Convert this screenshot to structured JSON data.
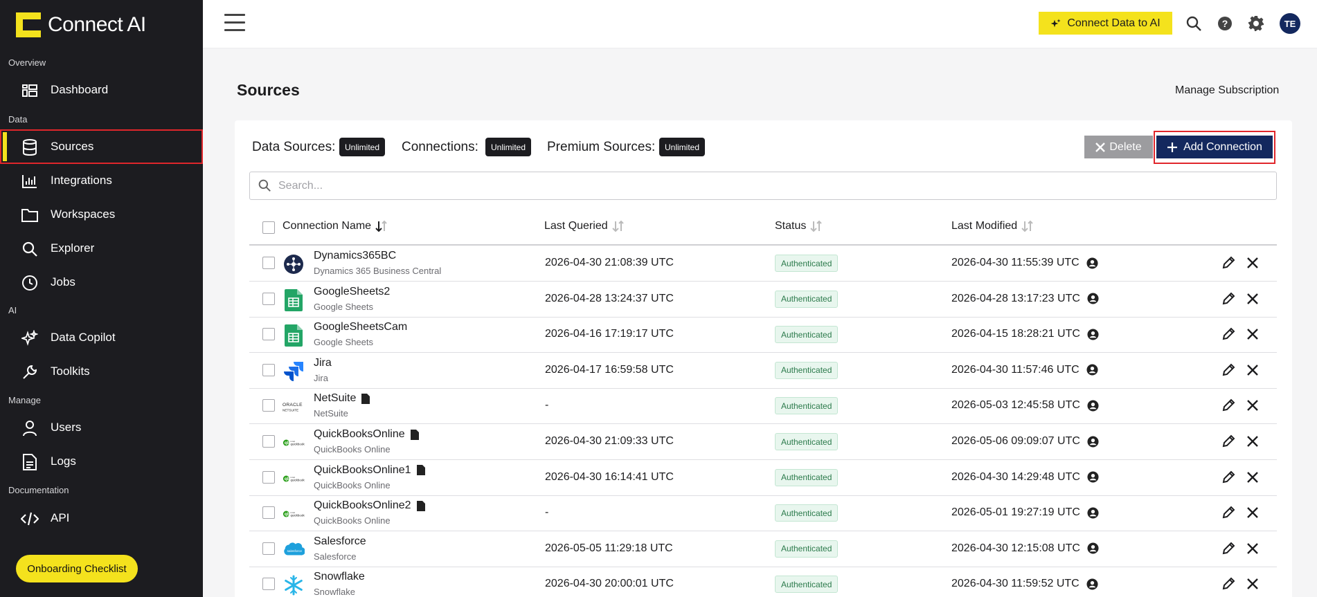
{
  "app": {
    "name": "Connect AI"
  },
  "sidebar": {
    "sections": [
      {
        "label": "Overview"
      },
      {
        "label": "Data"
      },
      {
        "label": "AI"
      },
      {
        "label": "Manage"
      },
      {
        "label": "Documentation"
      }
    ],
    "items": [
      {
        "label": "Dashboard",
        "icon": "dashboard-icon"
      },
      {
        "label": "Sources",
        "icon": "database-icon",
        "active": true
      },
      {
        "label": "Integrations",
        "icon": "bar-chart-icon"
      },
      {
        "label": "Workspaces",
        "icon": "folder-icon"
      },
      {
        "label": "Explorer",
        "icon": "search-icon"
      },
      {
        "label": "Jobs",
        "icon": "clock-icon"
      },
      {
        "label": "Data Copilot",
        "icon": "sparkle-icon"
      },
      {
        "label": "Toolkits",
        "icon": "wrench-icon"
      },
      {
        "label": "Users",
        "icon": "user-icon"
      },
      {
        "label": "Logs",
        "icon": "document-icon"
      },
      {
        "label": "API",
        "icon": "code-icon"
      }
    ],
    "onboarding_label": "Onboarding Checklist"
  },
  "topbar": {
    "connect_label": "Connect Data to AI",
    "avatar_initials": "TE",
    "accent_color": "#f4e21d",
    "brand_navy": "#13285e"
  },
  "page": {
    "title": "Sources",
    "manage_subscription": "Manage Subscription"
  },
  "stats": {
    "data_sources_label": "Data Sources:",
    "data_sources_value": "Unlimited",
    "connections_label": "Connections:",
    "connections_value": "Unlimited",
    "premium_label": "Premium Sources:",
    "premium_value": "Unlimited"
  },
  "actions": {
    "delete_label": "Delete",
    "add_label": "Add Connection"
  },
  "search": {
    "placeholder": "Search..."
  },
  "table": {
    "columns": [
      "Connection Name",
      "Last Queried",
      "Status",
      "Last Modified"
    ],
    "rows": [
      {
        "name": "Dynamics365BC",
        "type": "Dynamics 365 Business Central",
        "logo": "dynamics-logo",
        "file": false,
        "last_queried": "2026-04-30 21:08:39 UTC",
        "status": "Authenticated",
        "last_modified": "2026-04-30 11:55:39 UTC"
      },
      {
        "name": "GoogleSheets2",
        "type": "Google Sheets",
        "logo": "google-sheets-logo",
        "file": false,
        "last_queried": "2026-04-28 13:24:37 UTC",
        "status": "Authenticated",
        "last_modified": "2026-04-28 13:17:23 UTC"
      },
      {
        "name": "GoogleSheetsCam",
        "type": "Google Sheets",
        "logo": "google-sheets-logo",
        "file": false,
        "last_queried": "2026-04-16 17:19:17 UTC",
        "status": "Authenticated",
        "last_modified": "2026-04-15 18:28:21 UTC"
      },
      {
        "name": "Jira",
        "type": "Jira",
        "logo": "jira-logo",
        "file": false,
        "last_queried": "2026-04-17 16:59:58 UTC",
        "status": "Authenticated",
        "last_modified": "2026-04-30 11:57:46 UTC"
      },
      {
        "name": "NetSuite",
        "type": "NetSuite",
        "logo": "netsuite-logo",
        "file": true,
        "last_queried": "-",
        "status": "Authenticated",
        "last_modified": "2026-05-03 12:45:58 UTC"
      },
      {
        "name": "QuickBooksOnline",
        "type": "QuickBooks Online",
        "logo": "quickbooks-logo",
        "file": true,
        "last_queried": "2026-04-30 21:09:33 UTC",
        "status": "Authenticated",
        "last_modified": "2026-05-06 09:09:07 UTC"
      },
      {
        "name": "QuickBooksOnline1",
        "type": "QuickBooks Online",
        "logo": "quickbooks-logo",
        "file": true,
        "last_queried": "2026-04-30 16:14:41 UTC",
        "status": "Authenticated",
        "last_modified": "2026-04-30 14:29:48 UTC"
      },
      {
        "name": "QuickBooksOnline2",
        "type": "QuickBooks Online",
        "logo": "quickbooks-logo",
        "file": true,
        "last_queried": "-",
        "status": "Authenticated",
        "last_modified": "2026-05-01 19:27:19 UTC"
      },
      {
        "name": "Salesforce",
        "type": "Salesforce",
        "logo": "salesforce-logo",
        "file": false,
        "last_queried": "2026-05-05 11:29:18 UTC",
        "status": "Authenticated",
        "last_modified": "2026-04-30 12:15:08 UTC"
      },
      {
        "name": "Snowflake",
        "type": "Snowflake",
        "logo": "snowflake-logo",
        "file": false,
        "last_queried": "2026-04-30 20:00:01 UTC",
        "status": "Authenticated",
        "last_modified": "2026-04-30 11:59:52 UTC"
      }
    ]
  }
}
